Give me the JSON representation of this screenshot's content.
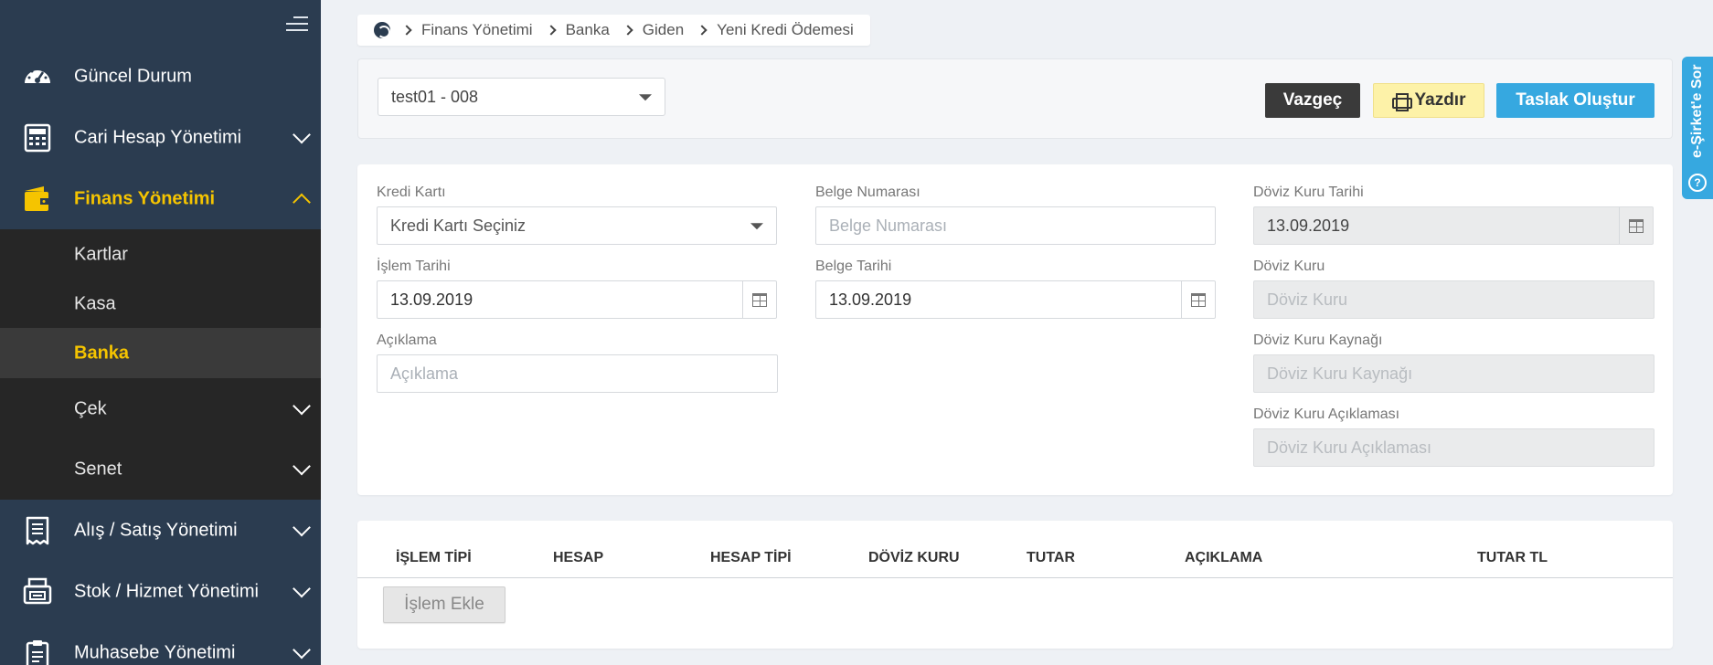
{
  "sidebar": {
    "items": [
      {
        "label": "Güncel Durum",
        "icon": "dashboard-icon"
      },
      {
        "label": "Cari Hesap Yönetimi",
        "icon": "calculator-icon"
      },
      {
        "label": "Finans Yönetimi",
        "icon": "wallet-icon"
      },
      {
        "label": "Alış / Satış Yönetimi",
        "icon": "receipt-icon"
      },
      {
        "label": "Stok / Hizmet Yönetimi",
        "icon": "printer-box-icon"
      },
      {
        "label": "Muhasebe Yönetimi",
        "icon": "clipboard-icon"
      }
    ],
    "submenu": [
      {
        "label": "Kartlar"
      },
      {
        "label": "Kasa"
      },
      {
        "label": "Banka"
      },
      {
        "label": "Çek"
      },
      {
        "label": "Senet"
      }
    ]
  },
  "breadcrumb": [
    "Finans Yönetimi",
    "Banka",
    "Giden",
    "Yeni Kredi Ödemesi"
  ],
  "toolbar": {
    "company_select": "test01 - 008",
    "cancel_label": "Vazgeç",
    "print_label": "Yazdır",
    "draft_label": "Taslak Oluştur"
  },
  "form": {
    "kredi_karti": {
      "label": "Kredi Kartı",
      "value": "Kredi Kartı Seçiniz"
    },
    "islem_tarihi": {
      "label": "İşlem Tarihi",
      "value": "13.09.2019"
    },
    "aciklama": {
      "label": "Açıklama",
      "placeholder": "Açıklama"
    },
    "belge_numarasi": {
      "label": "Belge Numarası",
      "placeholder": "Belge Numarası"
    },
    "belge_tarihi": {
      "label": "Belge Tarihi",
      "value": "13.09.2019"
    },
    "doviz_kuru_tarihi": {
      "label": "Döviz Kuru Tarihi",
      "value": "13.09.2019"
    },
    "doviz_kuru": {
      "label": "Döviz Kuru",
      "placeholder": "Döviz Kuru"
    },
    "doviz_kuru_kaynagi": {
      "label": "Döviz Kuru Kaynağı",
      "placeholder": "Döviz Kuru Kaynağı"
    },
    "doviz_kuru_aciklamasi": {
      "label": "Döviz Kuru Açıklaması",
      "placeholder": "Döviz Kuru Açıklaması"
    }
  },
  "table": {
    "columns": [
      "İŞLEM TİPİ",
      "HESAP",
      "HESAP TİPİ",
      "DÖVİZ KURU",
      "TUTAR",
      "AÇIKLAMA",
      "TUTAR TL"
    ],
    "add_label": "İşlem Ekle"
  },
  "help_tab": {
    "label": "e-Şirket'e Sor"
  },
  "colors": {
    "sidebar_bg": "#2b3c50",
    "accent_yellow": "#f5c400",
    "accent_blue": "#36a8e0"
  }
}
